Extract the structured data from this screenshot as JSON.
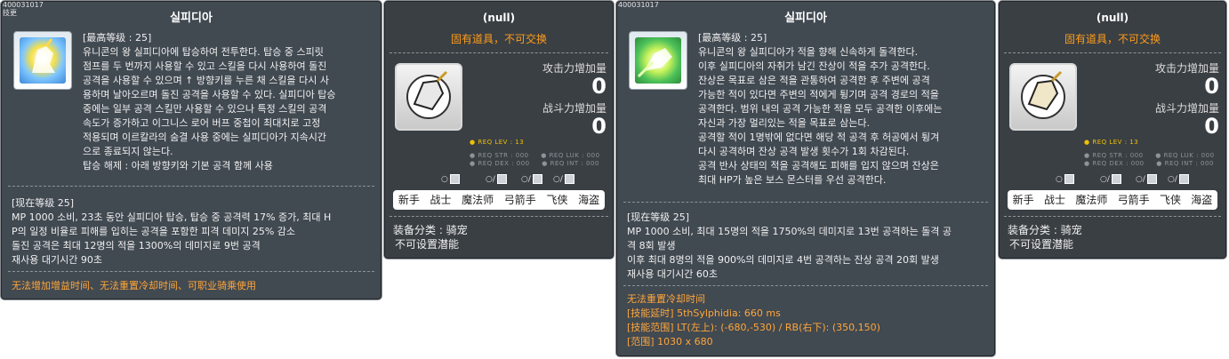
{
  "skill1": {
    "id": "400031017",
    "flag": "技更",
    "title": "실피디아",
    "desc_lines": [
      "[最高等级 : 25]",
      "유니콘의 왕 실피디아에 탑승하여 전투한다. 탑승 중 스피릿",
      "점프를 두 번까지 사용할 수 있고 스킬을 다시 사용하여 돌진",
      "공격을 사용할 수 있으며 ↑ 방향키를 누른 채 스킬을 다시 사",
      "용하며 날아오르며 돌진 공격을 사용할 수 있다. 실피디아 탑승",
      "중에는 일부 공격 스킬만 사용할 수 있으나 특정 스킬의 공격",
      "속도가 증가하고 이그니스 로어 버프 중첩이 최대치로 고정",
      "적용되며 이르칼라의 숨결 사용 중에는 실피디아가 지속시간",
      "으로 종료되지 않는다.",
      "탑승 해제 : 아래 방향키와 기본 공격 함께 사용"
    ],
    "level_lines": [
      "[现在等级 25]",
      "MP 1000 소비, 23초 동안 실피디아 탑승, 탑승 중 공격력 17% 증가, 최대 H",
      "P의 일정 비율로 피해를 입히는 공격을 포함한 피격 데미지 25% 감소",
      "돌진 공격은 최대 12명의 적을 1300%의 데미지로 9번 공격",
      "재사용 대기시간 90초"
    ],
    "footer": "无法增加增益时间、无法重置冷却时间、可职业骑乘使用"
  },
  "item1": {
    "title": "(null)",
    "subtitle": "固有道具，不可交换",
    "attack_label": "攻击力增加量",
    "attack_value": "0",
    "combat_label": "战斗力增加量",
    "combat_value": "0",
    "req_lev": "● REQ LEV :   13",
    "req_line1": "● REQ STR : 000     ● REQ LUK : 000",
    "req_line2": "● REQ DEX : 000     ● REQ INT : 000",
    "dots": [
      "○",
      "○/",
      "○/",
      "○/"
    ],
    "jobs": [
      "新手",
      "战士",
      "魔法师",
      "弓箭手",
      "飞侠",
      "海盗"
    ],
    "category_line": "装备分类 : 骑宠",
    "potential_line": "不可设置潜能"
  },
  "skill2": {
    "id": "400031017",
    "title": "실피디아",
    "desc_lines": [
      "[最高等级 : 25]",
      "유니콘의 왕 실피디아가 적을 향해 신속하게 돌격한다.",
      "이후 실피디아의 자취가 남긴 잔상이 적을 추가 공격한다.",
      "잔상은 목표로 삼은 적을 관통하여 공격한 후 주변에 공격",
      "가능한 적이 있다면 주변의 적에게 튕기며 공격 경로의 적을",
      "공격한다. 범위 내의 공격 가능한 적을 모두 공격한 이후에는",
      "자신과 가장 멀리있는 적을 목표로 삼는다.",
      "공격할 적이 1명밖에 없다면 해당 적 공격 후 허공에서 튕겨",
      "다시 공격하며 잔상 공격 발생 횟수가 1회 차감된다.",
      "공격 반사 상태의 적을 공격해도 피해를 입지 않으며 잔상은",
      "최대 HP가 높은 보스 몬스터를 우선 공격한다."
    ],
    "level_lines": [
      "[现在等级 25]",
      "MP 1000 소비, 최대 15명의 적을 1750%의 데미지로 13번 공격하는 돌격 공",
      "격 8회 발생",
      "이후 최대 8명의 적을 900%의 데미지로 4번 공격하는 잔상 공격 20회 발생",
      "재사용 대기시간 60초"
    ],
    "footer_lines": [
      "无法重置冷却时间",
      "[技能延时] 5thSylphidia: 660 ms",
      "[技能范围] LT(左上): (-680,-530) / RB(右下): (350,150)",
      "[范围] 1030 x 680"
    ]
  },
  "item2": {
    "title": "(null)",
    "subtitle": "固有道具，不可交换",
    "attack_label": "攻击力增加量",
    "attack_value": "0",
    "combat_label": "战斗力增加量",
    "combat_value": "0",
    "req_lev": "● REQ LEV :   13",
    "req_line1": "● REQ STR : 000     ● REQ LUK : 000",
    "req_line2": "● REQ DEX : 000     ● REQ INT : 000",
    "dots": [
      "○",
      "○/",
      "○/",
      "○/"
    ],
    "jobs": [
      "新手",
      "战士",
      "魔法师",
      "弓箭手",
      "飞侠",
      "海盗"
    ],
    "category_line": "装备分类 : 骑宠",
    "potential_line": "不可设置潜能"
  },
  "colors": {
    "panel_bg": "#414951",
    "accent_orange": "#ffa63a",
    "req_level": "#f0c000"
  }
}
